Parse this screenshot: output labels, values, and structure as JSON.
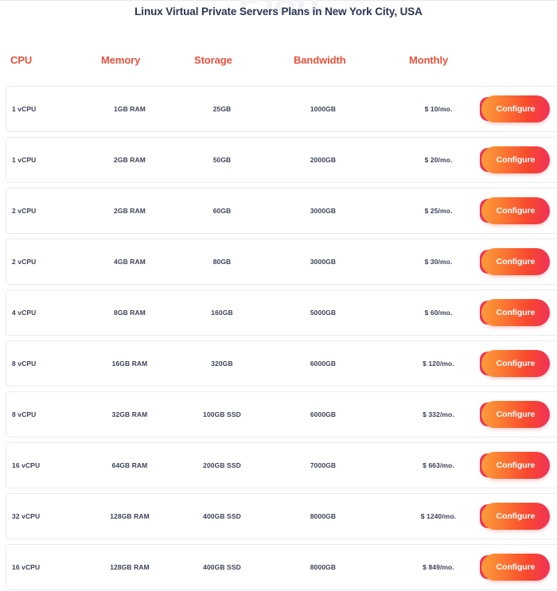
{
  "page": {
    "title": "Linux Virtual Private Servers Plans in New York City, USA",
    "watermark": "Plan",
    "accent_color": "#e8523c",
    "button_gradient_start": "#fb9e3a",
    "button_gradient_end": "#f0315a",
    "text_color": "#3c4257",
    "title_color": "#2b3553"
  },
  "table": {
    "columns": [
      {
        "key": "cpu",
        "label": "CPU"
      },
      {
        "key": "memory",
        "label": "Memory"
      },
      {
        "key": "storage",
        "label": "Storage"
      },
      {
        "key": "bandwidth",
        "label": "Bandwidth"
      },
      {
        "key": "monthly",
        "label": "Monthly"
      }
    ],
    "action_label": "Configure",
    "rows": [
      {
        "cpu": "1 vCPU",
        "memory": "1GB RAM",
        "storage": "25GB",
        "bandwidth": "1000GB",
        "monthly": "$ 10/mo.",
        "action": "Configure"
      },
      {
        "cpu": "1 vCPU",
        "memory": "2GB RAM",
        "storage": "50GB",
        "bandwidth": "2000GB",
        "monthly": "$ 20/mo.",
        "action": "Configure"
      },
      {
        "cpu": "2 vCPU",
        "memory": "2GB RAM",
        "storage": "60GB",
        "bandwidth": "3000GB",
        "monthly": "$ 25/mo.",
        "action": "Configure"
      },
      {
        "cpu": "2 vCPU",
        "memory": "4GB RAM",
        "storage": "80GB",
        "bandwidth": "3000GB",
        "monthly": "$ 30/mo.",
        "action": "Configure"
      },
      {
        "cpu": "4 vCPU",
        "memory": "8GB RAM",
        "storage": "160GB",
        "bandwidth": "5000GB",
        "monthly": "$ 60/mo.",
        "action": "Configure"
      },
      {
        "cpu": "8 vCPU",
        "memory": "16GB RAM",
        "storage": "320GB",
        "bandwidth": "6000GB",
        "monthly": "$ 120/mo.",
        "action": "Configure"
      },
      {
        "cpu": "8 vCPU",
        "memory": "32GB RAM",
        "storage": "100GB SSD",
        "bandwidth": "6000GB",
        "monthly": "$ 332/mo.",
        "action": "Configure"
      },
      {
        "cpu": "16 vCPU",
        "memory": "64GB RAM",
        "storage": "200GB SSD",
        "bandwidth": "7000GB",
        "monthly": "$ 663/mo.",
        "action": "Configure"
      },
      {
        "cpu": "32 vCPU",
        "memory": "128GB RAM",
        "storage": "400GB SSD",
        "bandwidth": "8000GB",
        "monthly": "$ 1240/mo.",
        "action": "Configure"
      },
      {
        "cpu": "16 vCPU",
        "memory": "128GB RAM",
        "storage": "400GB SSD",
        "bandwidth": "8000GB",
        "monthly": "$ 849/mo.",
        "action": "Configure"
      }
    ]
  }
}
